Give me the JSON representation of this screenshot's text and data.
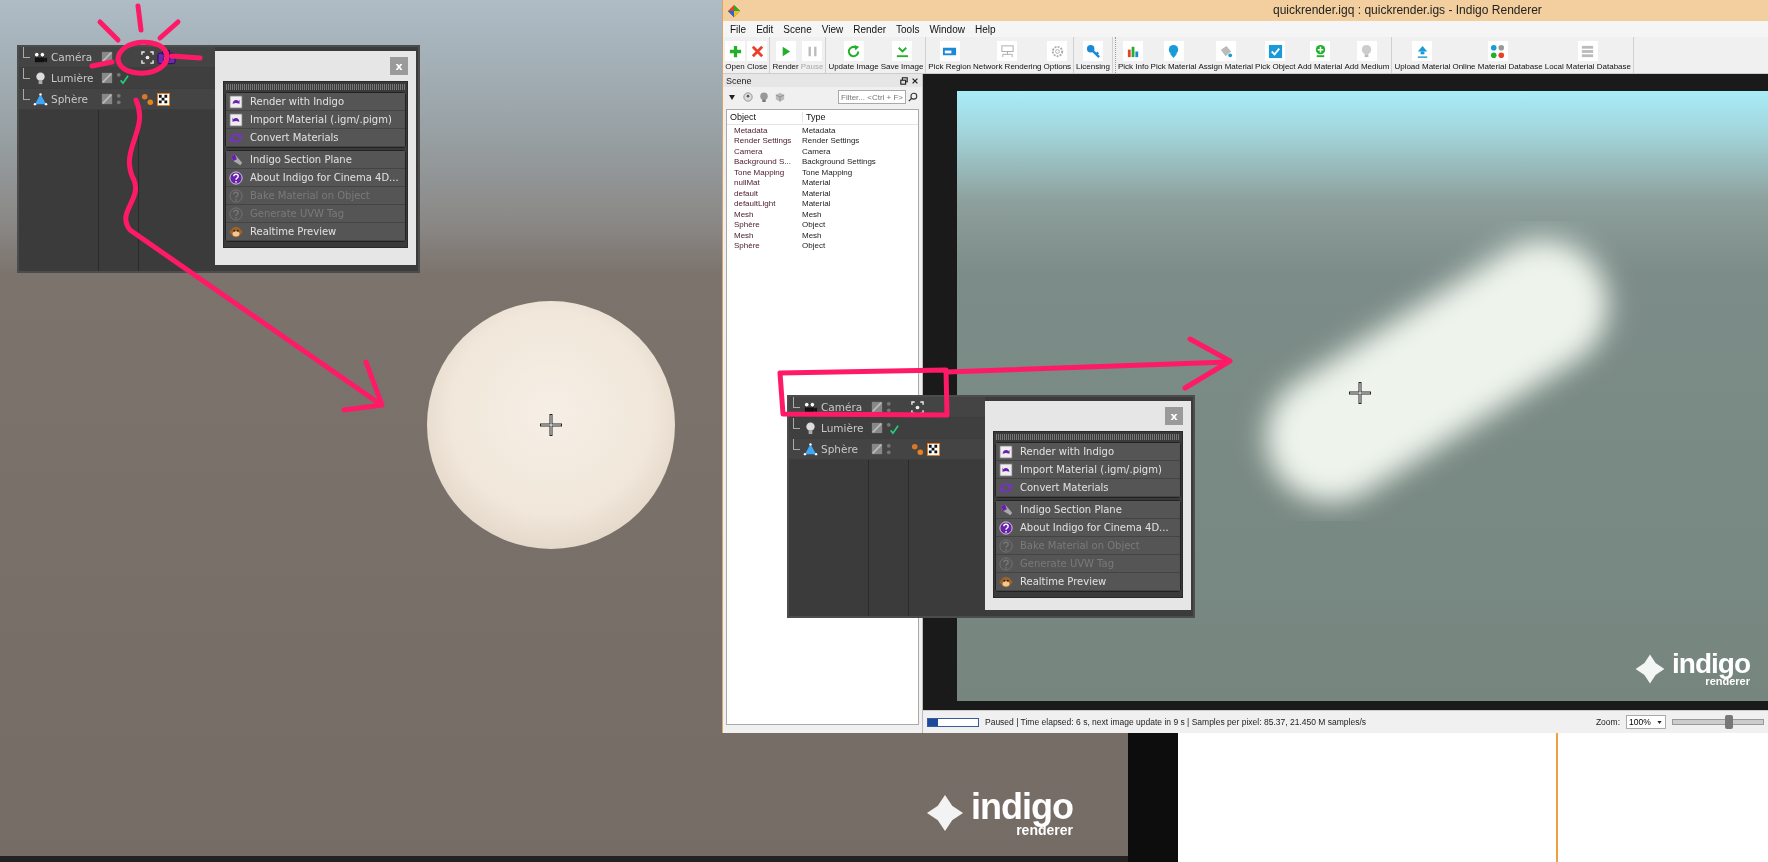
{
  "background_logo": {
    "word": "indigo",
    "tagline": "renderer"
  },
  "object_panels": [
    {
      "objects": [
        {
          "name": "Caméra",
          "kind": "camera",
          "checked": false,
          "tags": [
            {
              "kind": "target"
            },
            {
              "kind": "indigo-camera"
            }
          ]
        },
        {
          "name": "Lumière",
          "kind": "light",
          "checked": true
        },
        {
          "name": "Sphère",
          "kind": "sphere",
          "checked": false,
          "tags": [
            {
              "kind": "material"
            },
            {
              "kind": "checker"
            }
          ]
        }
      ],
      "close_label": "x",
      "menu_groups": [
        {
          "items": [
            {
              "label": "Render with Indigo",
              "kind": "render",
              "disabled": false
            },
            {
              "label": "Import Material (.igm/.pigm)",
              "kind": "import",
              "disabled": false
            },
            {
              "label": "Convert Materials",
              "kind": "convert",
              "disabled": false
            }
          ]
        },
        {
          "items": [
            {
              "label": "Indigo Section Plane",
              "kind": "section",
              "disabled": false
            },
            {
              "label": "About Indigo for Cinema 4D...",
              "kind": "help",
              "disabled": false
            },
            {
              "label": "Bake Material on Object",
              "kind": "help",
              "disabled": true
            },
            {
              "label": "Generate UVW Tag",
              "kind": "help",
              "disabled": true
            },
            {
              "label": "Realtime Preview",
              "kind": "monkey",
              "disabled": false
            }
          ]
        }
      ]
    },
    {
      "objects": [
        {
          "name": "Caméra",
          "kind": "camera",
          "checked": false,
          "tags": [
            {
              "kind": "target"
            }
          ]
        },
        {
          "name": "Lumière",
          "kind": "light",
          "checked": true
        },
        {
          "name": "Sphère",
          "kind": "sphere",
          "checked": false,
          "tags": [
            {
              "kind": "material"
            },
            {
              "kind": "checker"
            }
          ]
        }
      ],
      "close_label": "x",
      "menu_groups": [
        {
          "items": [
            {
              "label": "Render with Indigo",
              "kind": "render",
              "disabled": false
            },
            {
              "label": "Import Material (.igm/.pigm)",
              "kind": "import",
              "disabled": false
            },
            {
              "label": "Convert Materials",
              "kind": "convert",
              "disabled": false
            }
          ]
        },
        {
          "items": [
            {
              "label": "Indigo Section Plane",
              "kind": "section",
              "disabled": false
            },
            {
              "label": "About Indigo for Cinema 4D...",
              "kind": "help",
              "disabled": false
            },
            {
              "label": "Bake Material on Object",
              "kind": "help",
              "disabled": true
            },
            {
              "label": "Generate UVW Tag",
              "kind": "help",
              "disabled": true
            },
            {
              "label": "Realtime Preview",
              "kind": "monkey",
              "disabled": false
            }
          ]
        }
      ]
    }
  ],
  "window": {
    "title": "quickrender.igq : quickrender.igs - Indigo Renderer",
    "menu": [
      "File",
      "Edit",
      "Scene",
      "View",
      "Render",
      "Tools",
      "Window",
      "Help"
    ],
    "toolbar": [
      {
        "items": [
          {
            "label": "Open",
            "kind": "add",
            "disabled": false
          },
          {
            "label": "Close",
            "kind": "close",
            "disabled": false
          }
        ]
      },
      {
        "items": [
          {
            "label": "Render",
            "kind": "play",
            "disabled": false
          },
          {
            "label": "Pause",
            "kind": "pause",
            "disabled": true
          }
        ]
      },
      {
        "items": [
          {
            "label": "Update Image",
            "kind": "refresh",
            "disabled": false
          },
          {
            "label": "Save Image",
            "kind": "save",
            "disabled": false
          }
        ]
      },
      {
        "items": [
          {
            "label": "Pick Region",
            "kind": "region",
            "disabled": false
          },
          {
            "label": "Network Rendering",
            "kind": "network",
            "disabled": false
          },
          {
            "label": "Options",
            "kind": "gear",
            "disabled": false
          }
        ]
      },
      {
        "items": [
          {
            "label": "Licensing",
            "kind": "key",
            "disabled": false
          }
        ]
      },
      {
        "items": [
          {
            "label": "Pick Info",
            "kind": "chart",
            "disabled": false
          },
          {
            "label": "Pick Material",
            "kind": "pin",
            "disabled": false
          },
          {
            "label": "Assign Material",
            "kind": "bucket",
            "disabled": false
          },
          {
            "label": "Pick Object",
            "kind": "cube",
            "disabled": false
          },
          {
            "label": "Add Material",
            "kind": "add-pin",
            "disabled": false
          },
          {
            "label": "Add Medium",
            "kind": "bulb",
            "disabled": false
          }
        ]
      },
      {
        "items": [
          {
            "label": "Upload Material",
            "kind": "upload",
            "disabled": false
          },
          {
            "label": "Online Material Database",
            "kind": "dots",
            "disabled": false
          },
          {
            "label": "Local Material Database",
            "kind": "stack",
            "disabled": false
          }
        ]
      }
    ],
    "scene_panel": {
      "title": "Scene",
      "placeholder": "Filter... <Ctrl + F>",
      "columns": [
        "Object",
        "Type"
      ],
      "rows": [
        {
          "object": "Metadata",
          "type": "Metadata"
        },
        {
          "object": "Render Settings",
          "type": "Render Settings"
        },
        {
          "object": "Camera",
          "type": "Camera"
        },
        {
          "object": "Background S...",
          "type": "Background Settings"
        },
        {
          "object": "Tone Mapping",
          "type": "Tone Mapping"
        },
        {
          "object": "nullMat",
          "type": "Material"
        },
        {
          "object": "default",
          "type": "Material"
        },
        {
          "object": "defaultLight",
          "type": "Material"
        },
        {
          "object": "Mesh",
          "type": "Mesh"
        },
        {
          "object": "Sphère",
          "type": "Object"
        },
        {
          "object": "Mesh",
          "type": "Mesh"
        },
        {
          "object": "Sphère",
          "type": "Object"
        }
      ]
    },
    "render_logo": {
      "word": "indigo",
      "tagline": "renderer"
    },
    "status_bar": {
      "progress": {
        "level": 0.2
      },
      "text": "Paused | Time elapsed: 6 s, next image update in 9 s | Samples per pixel: 85.37, 21.450 M samples/s",
      "zoom_label": "Zoom:",
      "zoom_value": "100%",
      "zoom_slider": {
        "level": 0.62
      }
    }
  }
}
